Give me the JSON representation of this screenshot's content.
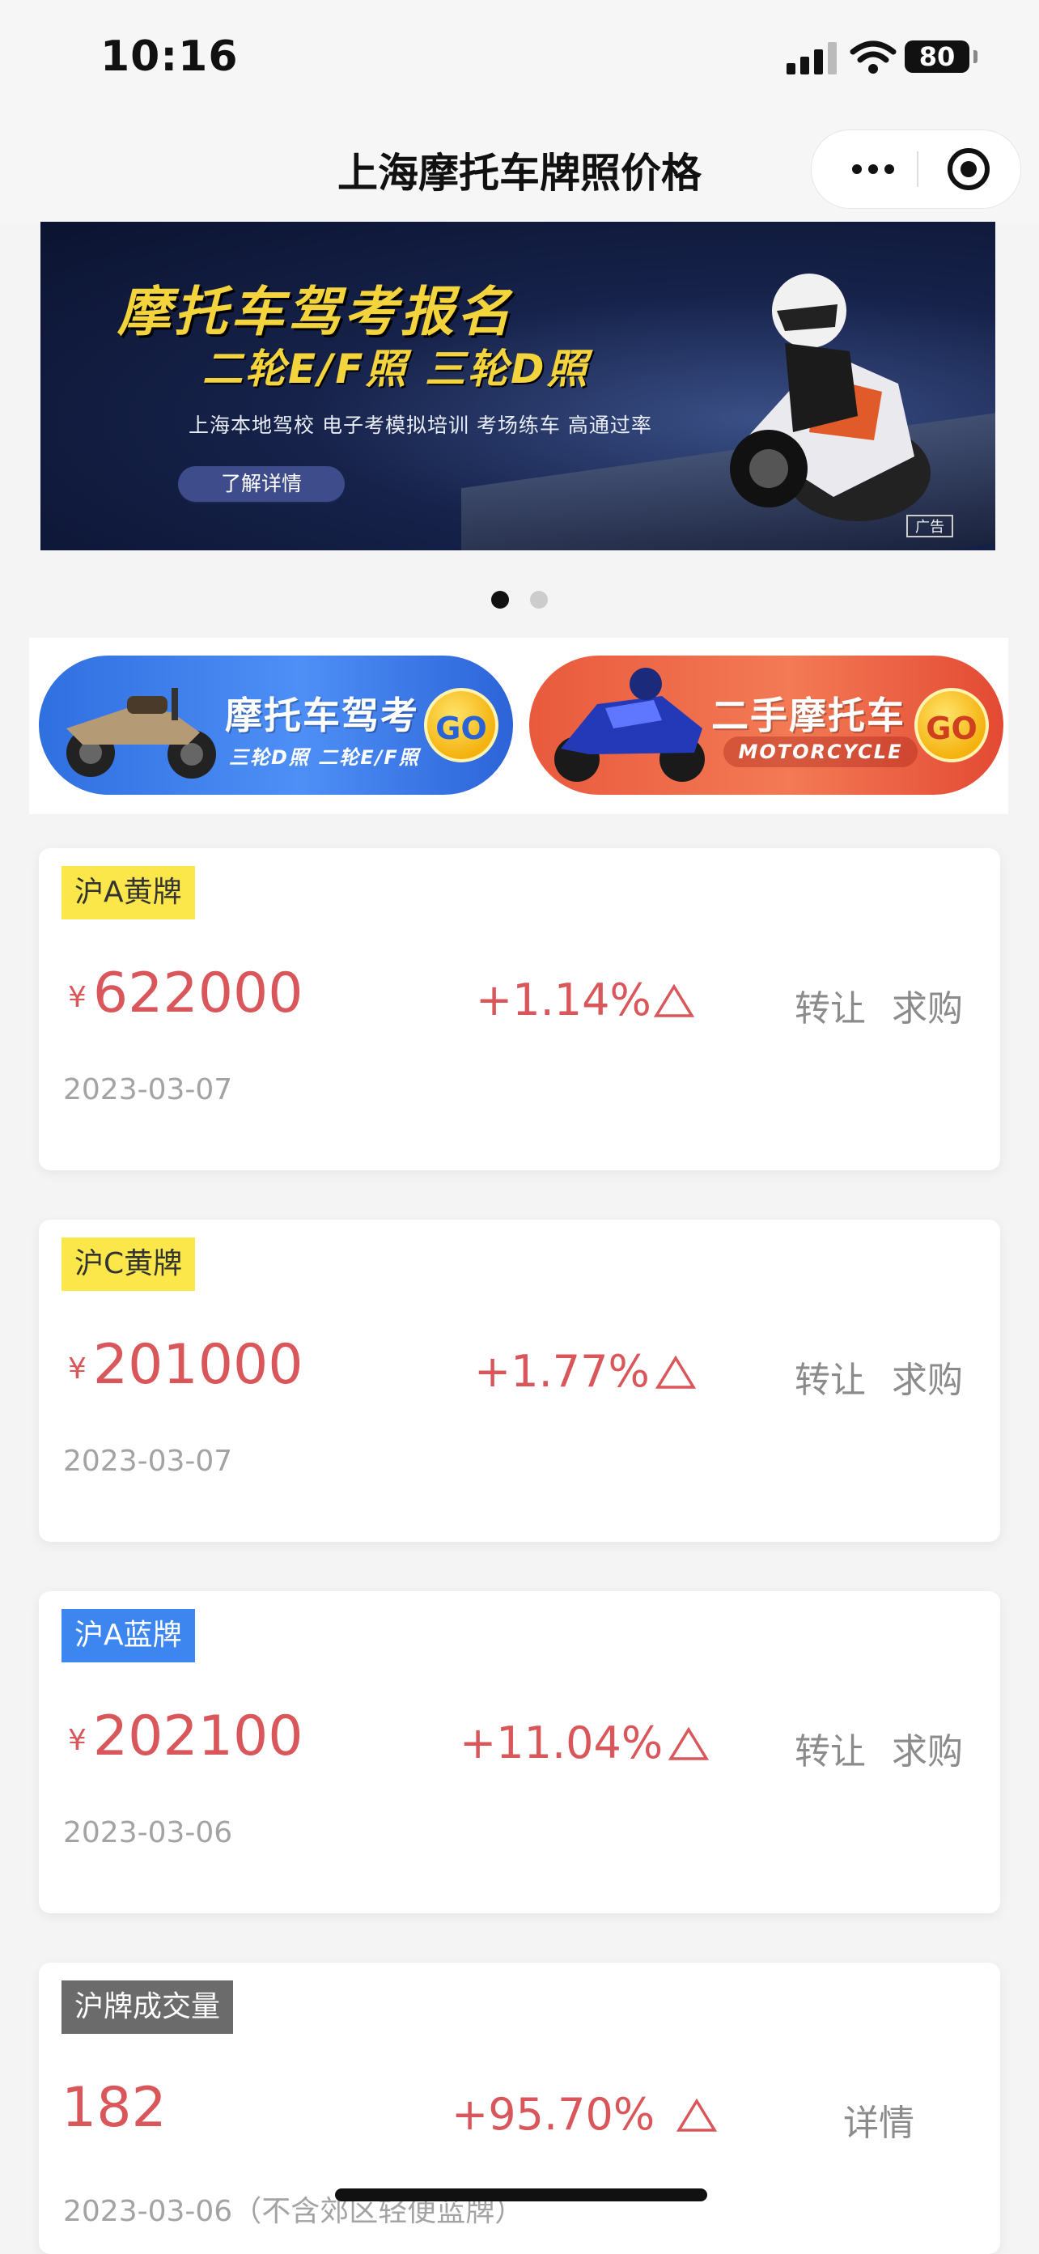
{
  "status_bar": {
    "time": "10:16",
    "battery": "80"
  },
  "nav": {
    "title": "上海摩托车牌照价格"
  },
  "banner": {
    "title": "摩托车驾考报名",
    "subtitle": "二轮E/F照 三轮D照",
    "description": "上海本地驾校 电子考模拟培训 考场练车 高通过率",
    "button": "了解详情",
    "ad_label": "广告"
  },
  "carousel": {
    "pages": 2,
    "active": 0
  },
  "entries": [
    {
      "title": "摩托车驾考",
      "subtitle": "三轮D照 二轮E/F照",
      "go": "GO"
    },
    {
      "title": "二手摩托车",
      "subtitle": "MOTORCYCLE",
      "go": "GO"
    }
  ],
  "cards": [
    {
      "tag": "沪A黄牌",
      "yen": "¥",
      "value": "622000",
      "change": "+1.14%",
      "actions": [
        "转让",
        "求购"
      ],
      "date": "2023-03-07"
    },
    {
      "tag": "沪C黄牌",
      "yen": "¥",
      "value": "201000",
      "change": "+1.77%",
      "actions": [
        "转让",
        "求购"
      ],
      "date": "2023-03-07"
    },
    {
      "tag": "沪A蓝牌",
      "yen": "¥",
      "value": "202100",
      "change": "+11.04%",
      "actions": [
        "转让",
        "求购"
      ],
      "date": "2023-03-06"
    },
    {
      "tag": "沪牌成交量",
      "value": "182",
      "change": "+95.70%",
      "actions": [
        "详情"
      ],
      "date": "2023-03-06（不含郊区轻便蓝牌）"
    }
  ],
  "colors": {
    "accent_red": "#d9565a",
    "tag_yellow": "#fbe74a",
    "tag_blue": "#3d86ef",
    "tag_gray": "#6b6b6b"
  }
}
